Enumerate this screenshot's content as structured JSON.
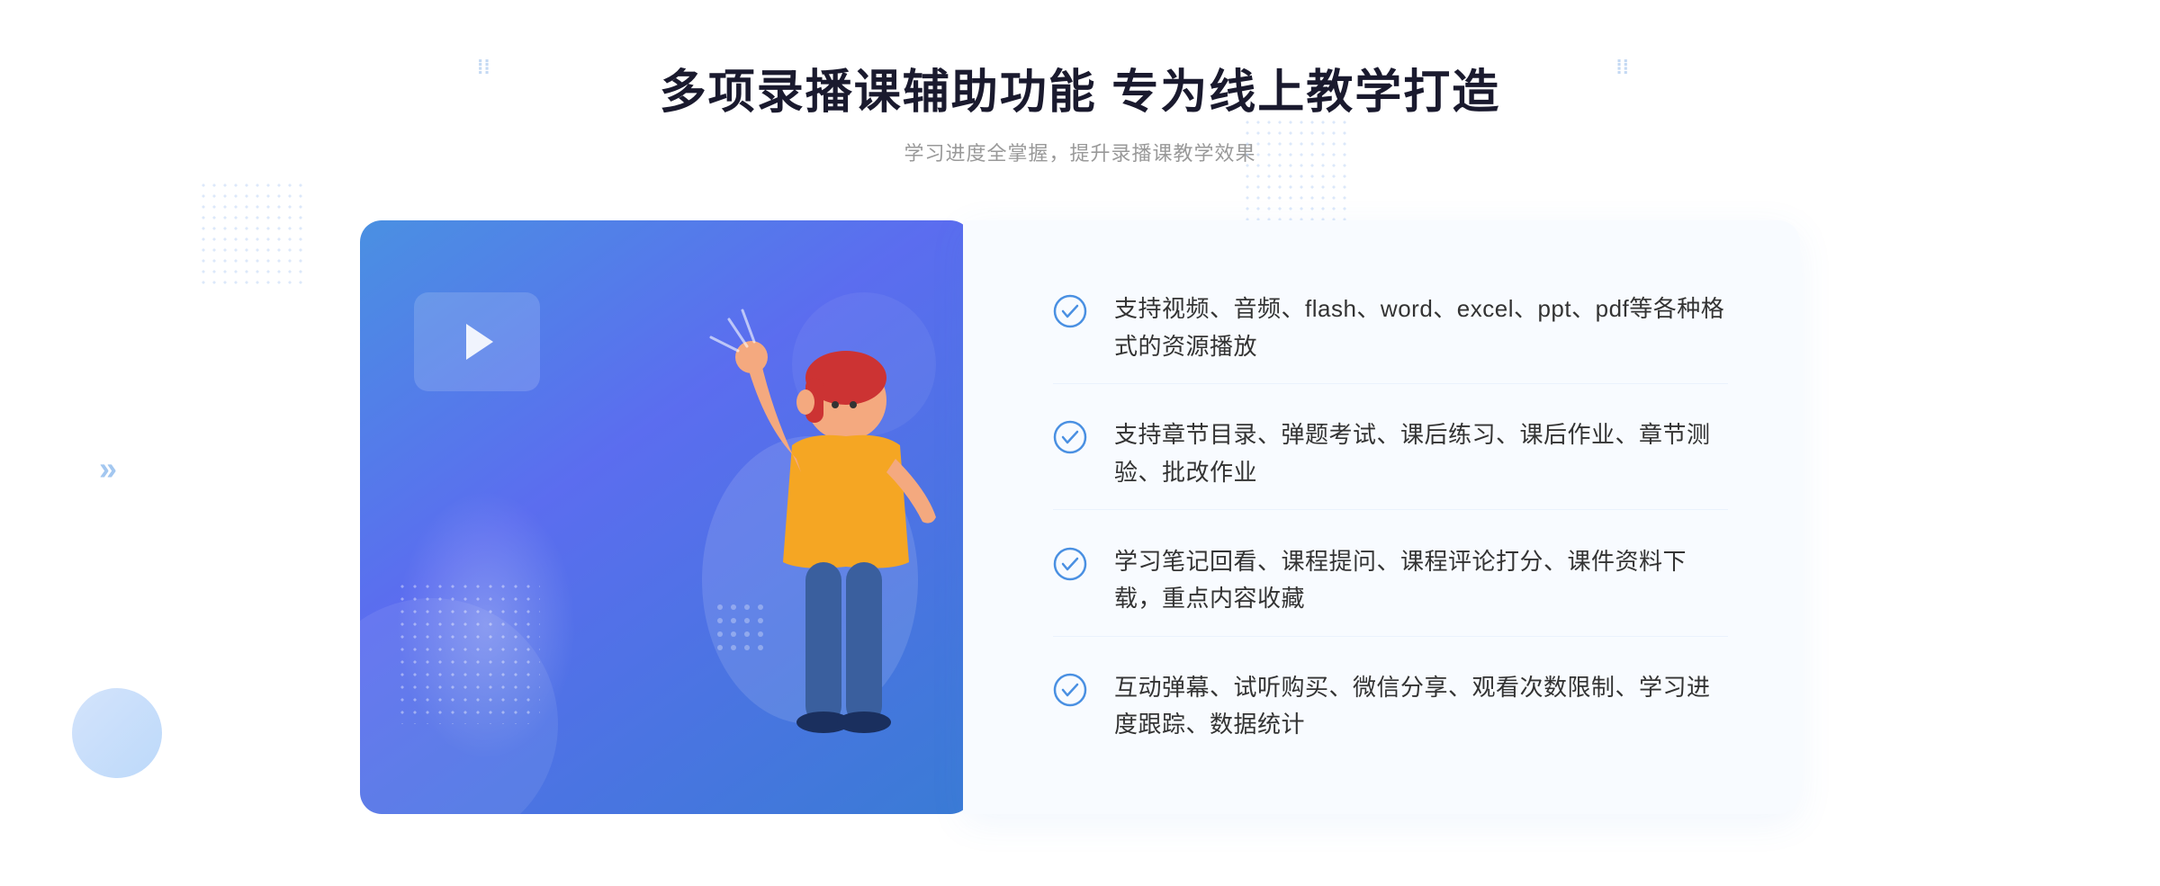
{
  "header": {
    "title": "多项录播课辅助功能 专为线上教学打造",
    "subtitle": "学习进度全掌握，提升录播课教学效果",
    "decor_left": "❮❮",
    "decor_right": "❯❯"
  },
  "features": [
    {
      "id": 1,
      "text": "支持视频、音频、flash、word、excel、ppt、pdf等各种格式的资源播放"
    },
    {
      "id": 2,
      "text": "支持章节目录、弹题考试、课后练习、课后作业、章节测验、批改作业"
    },
    {
      "id": 3,
      "text": "学习笔记回看、课程提问、课程评论打分、课件资料下载，重点内容收藏"
    },
    {
      "id": 4,
      "text": "互动弹幕、试听购买、微信分享、观看次数限制、学习进度跟踪、数据统计"
    }
  ],
  "colors": {
    "accent_blue": "#4a90e2",
    "title_dark": "#1a1a2e",
    "text_gray": "#333333",
    "sub_gray": "#999999",
    "bg_light": "#f8fbff",
    "check_color": "#4a90e2"
  },
  "chevron_left_decor": "»",
  "card": {
    "play_label": "play"
  }
}
